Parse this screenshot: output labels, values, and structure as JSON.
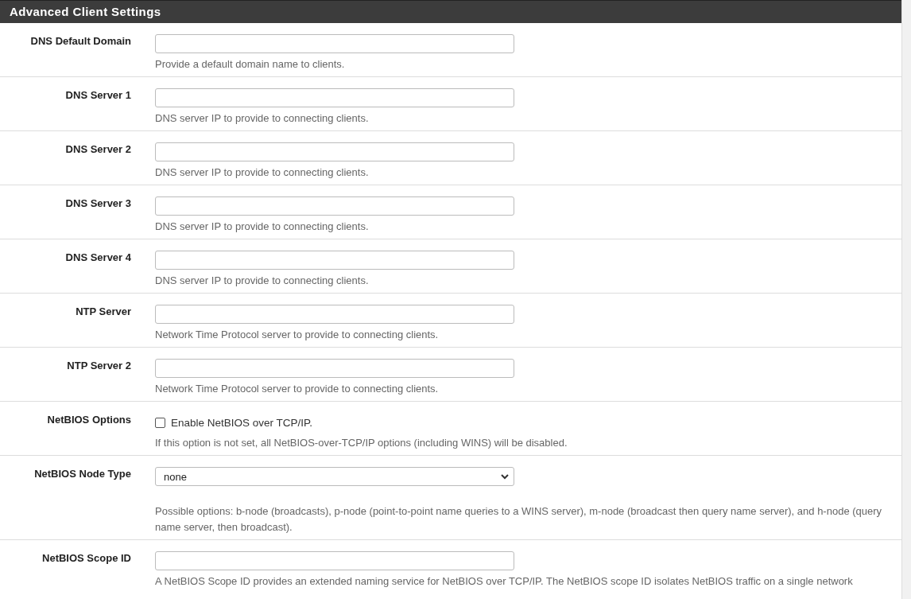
{
  "panel": {
    "title": "Advanced Client Settings"
  },
  "rows": [
    {
      "kind": "text",
      "label": "DNS Default Domain",
      "value": "",
      "help": "Provide a default domain name to clients."
    },
    {
      "kind": "text",
      "label": "DNS Server 1",
      "value": "",
      "help": "DNS server IP to provide to connecting clients."
    },
    {
      "kind": "text",
      "label": "DNS Server 2",
      "value": "",
      "help": "DNS server IP to provide to connecting clients."
    },
    {
      "kind": "text",
      "label": "DNS Server 3",
      "value": "",
      "help": "DNS server IP to provide to connecting clients."
    },
    {
      "kind": "text",
      "label": "DNS Server 4",
      "value": "",
      "help": "DNS server IP to provide to connecting clients."
    },
    {
      "kind": "text",
      "label": "NTP Server",
      "value": "",
      "help": "Network Time Protocol server to provide to connecting clients."
    },
    {
      "kind": "text",
      "label": "NTP Server 2",
      "value": "",
      "help": "Network Time Protocol server to provide to connecting clients."
    },
    {
      "kind": "checkbox",
      "label": "NetBIOS Options",
      "option": "Enable NetBIOS over TCP/IP.",
      "checked": false,
      "help": "If this option is not set, all NetBIOS-over-TCP/IP options (including WINS) will be disabled."
    },
    {
      "kind": "select",
      "label": "NetBIOS Node Type",
      "value": "none",
      "help": "Possible options: b-node (broadcasts), p-node (point-to-point name queries to a WINS server), m-node (broadcast then query name server), and h-node (query name server, then broadcast)."
    },
    {
      "kind": "text",
      "label": "NetBIOS Scope ID",
      "value": "",
      "help": "A NetBIOS Scope ID provides an extended naming service for NetBIOS over TCP/IP. The NetBIOS scope ID isolates NetBIOS traffic on a single network"
    }
  ]
}
